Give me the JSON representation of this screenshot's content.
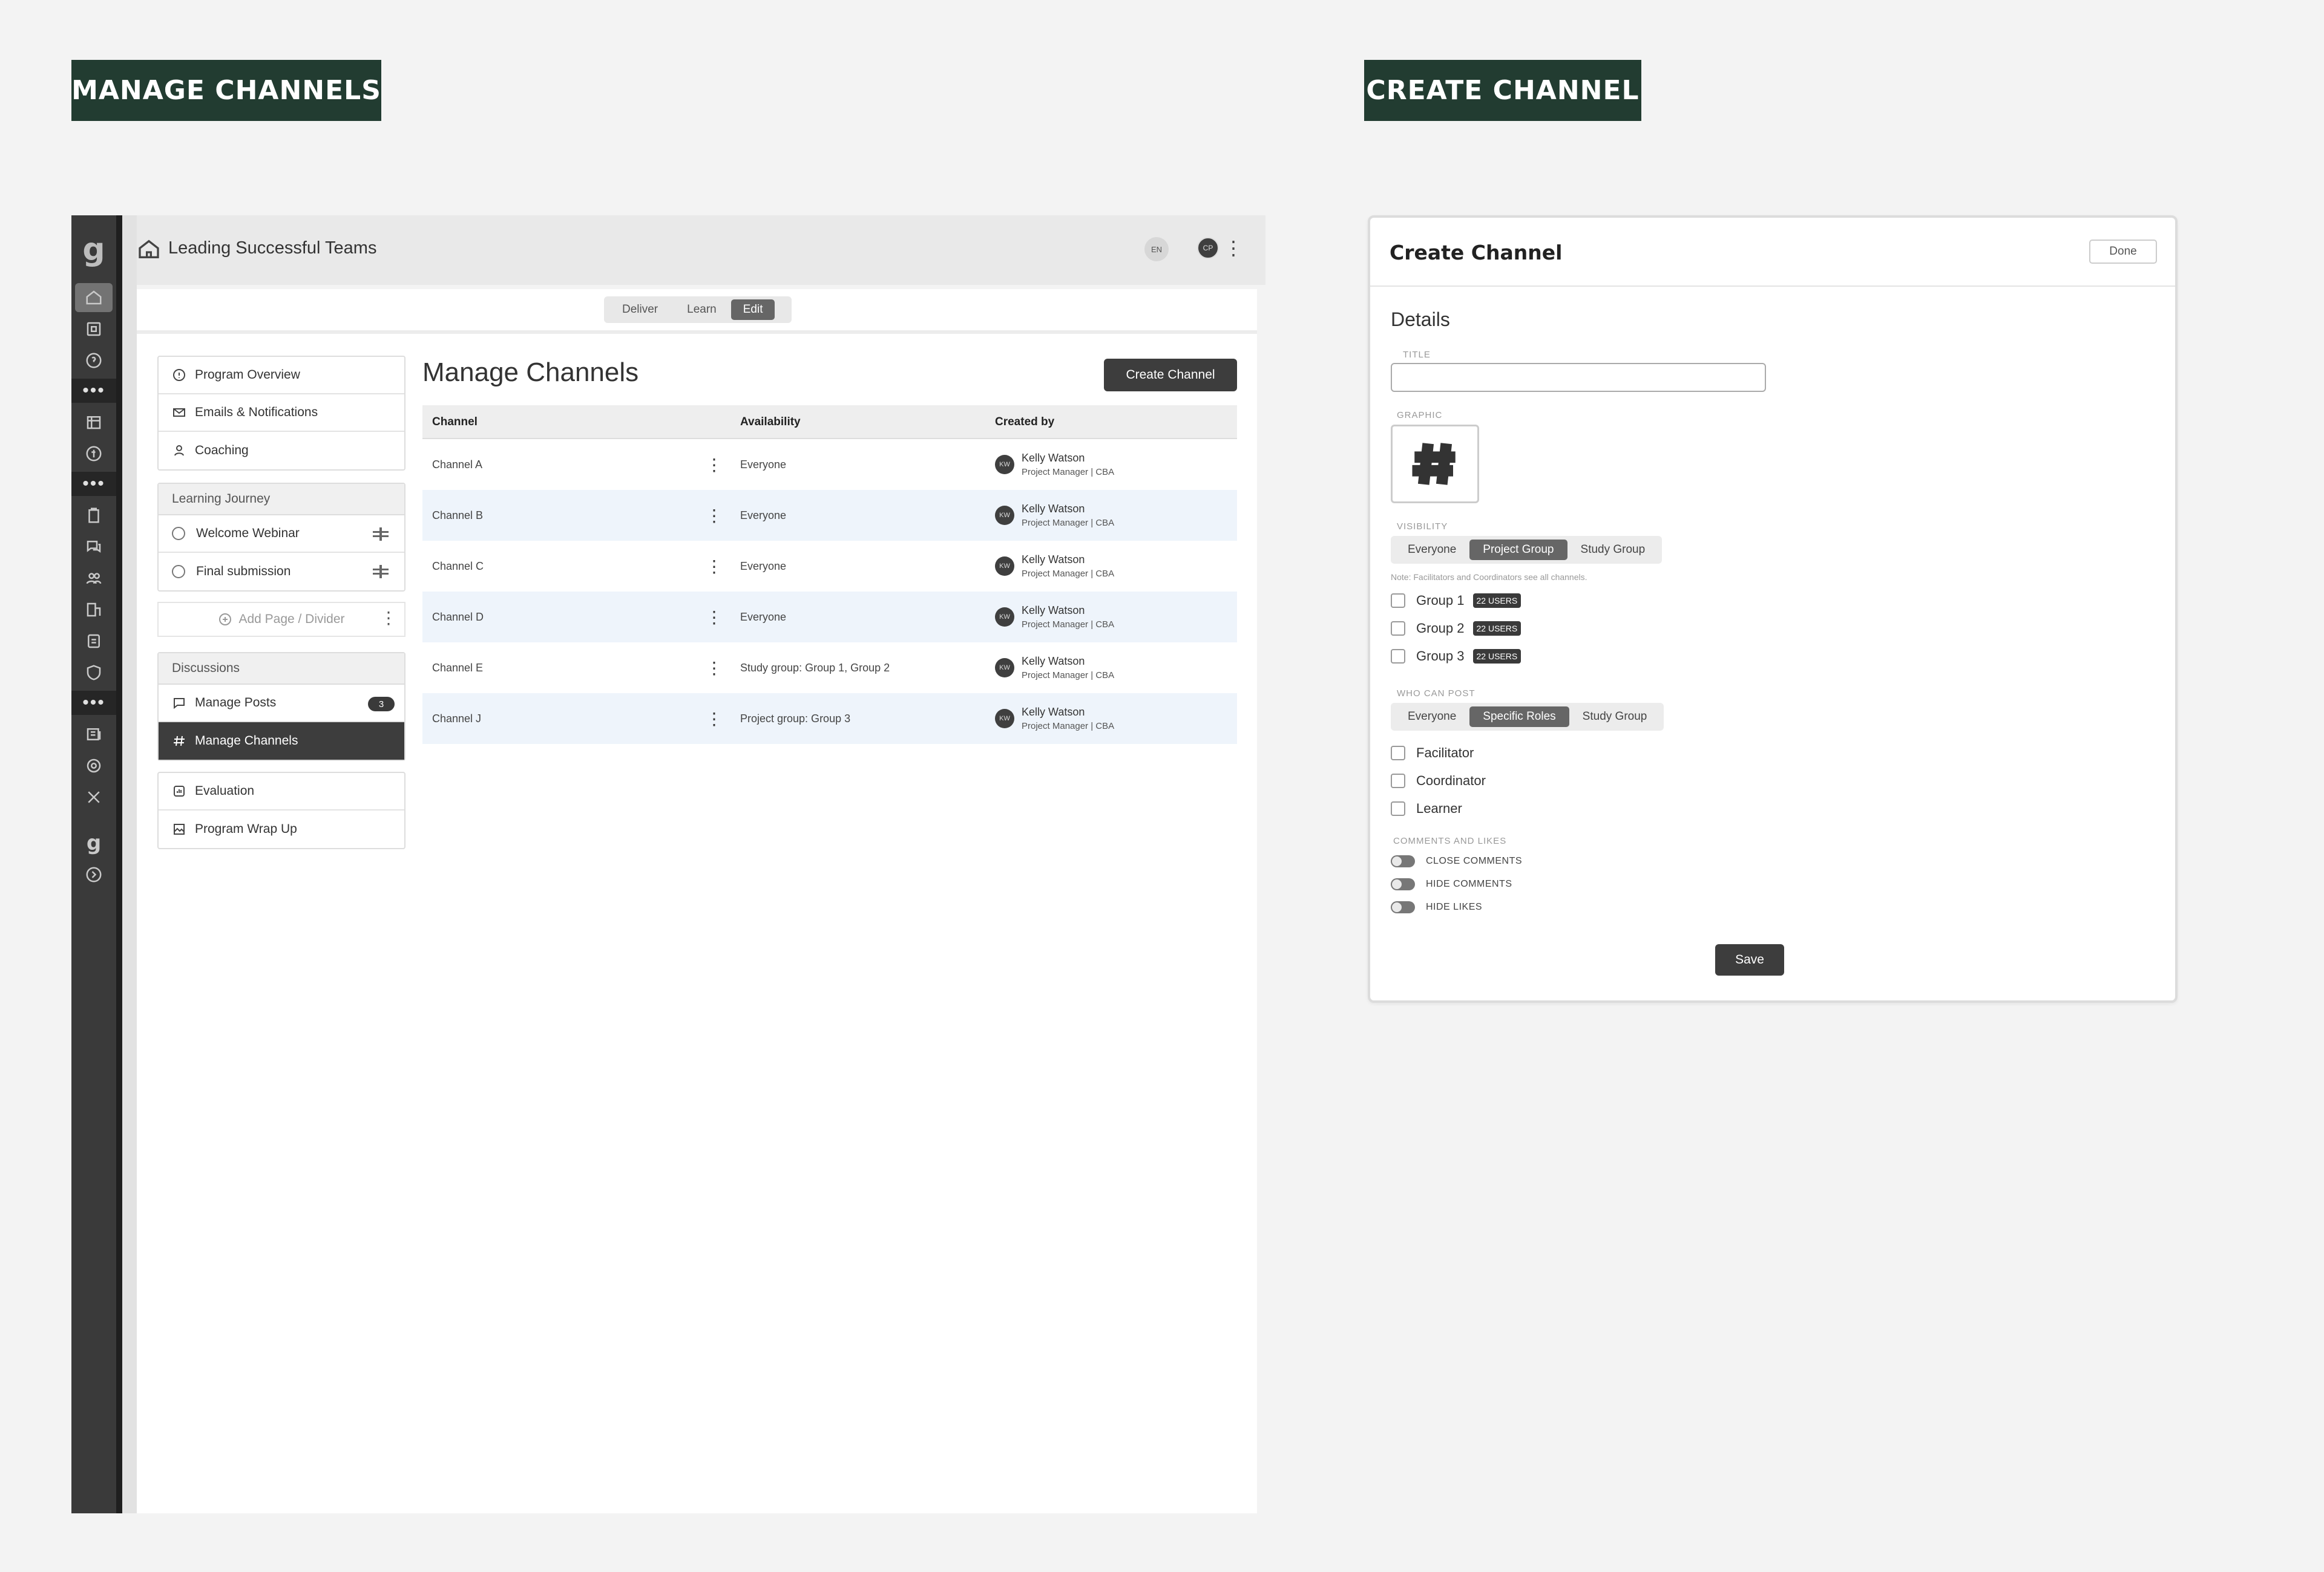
{
  "banners": {
    "left": "MANAGE CHANNELS",
    "right": "CREATE CHANNEL"
  },
  "rail": {
    "logo": "g",
    "icons": [
      "home-icon",
      "book-icon",
      "help-icon",
      "more-icon",
      "calendar-icon",
      "money-icon",
      "more-icon",
      "clipboard-icon",
      "chat-icon",
      "users-icon",
      "building-icon",
      "report-icon",
      "shield-icon",
      "more-icon",
      "news-icon",
      "settings-icon",
      "tools-icon",
      "logo-icon",
      "expand-icon"
    ],
    "dots": "•••",
    "bottom_logo": "g"
  },
  "topbar": {
    "title": "Leading Successful Teams",
    "lang": "EN",
    "avatar": "CP"
  },
  "modes": [
    "Deliver",
    "Learn",
    "Edit"
  ],
  "active_mode": "Edit",
  "nav": {
    "top_items": [
      "Program Overview",
      "Emails & Notifications",
      "Coaching"
    ],
    "journey_header": "Learning Journey",
    "journey_items": [
      "Welcome Webinar",
      "Final submission"
    ],
    "add_page": "Add Page / Divider",
    "discussions_header": "Discussions",
    "discussion_items": [
      "Manage Posts",
      "Manage Channels"
    ],
    "manage_posts_count": "3",
    "bottom_items": [
      "Evaluation",
      "Program Wrap Up"
    ]
  },
  "main": {
    "title": "Manage Channels",
    "create_button": "Create Channel",
    "columns": [
      "Channel",
      "Availability",
      "Created by"
    ],
    "rows": [
      {
        "channel": "Channel A",
        "availability": "Everyone",
        "initials": "KW",
        "name": "Kelly Watson",
        "role": "Project Manager | CBA"
      },
      {
        "channel": "Channel B",
        "availability": "Everyone",
        "initials": "KW",
        "name": "Kelly Watson",
        "role": "Project Manager | CBA"
      },
      {
        "channel": "Channel C",
        "availability": "Everyone",
        "initials": "KW",
        "name": "Kelly Watson",
        "role": "Project Manager | CBA"
      },
      {
        "channel": "Channel D",
        "availability": "Everyone",
        "initials": "KW",
        "name": "Kelly Watson",
        "role": "Project Manager | CBA"
      },
      {
        "channel": "Channel E",
        "availability": "Study group: Group 1, Group 2",
        "initials": "KW",
        "name": "Kelly Watson",
        "role": "Project Manager | CBA"
      },
      {
        "channel": "Channel J",
        "availability": "Project group: Group 3",
        "initials": "KW",
        "name": "Kelly Watson",
        "role": "Project Manager | CBA"
      }
    ]
  },
  "panel": {
    "title": "Create Channel",
    "done": "Done",
    "details": "Details",
    "title_label": "TITLE",
    "title_value": "",
    "graphic_label": "GRAPHIC",
    "visibility_label": "VISIBILITY",
    "visibility_options": [
      "Everyone",
      "Project Group",
      "Study Group"
    ],
    "visibility_selected": "Project Group",
    "note": "Note: Facilitators and Coordinators see all channels.",
    "groups": [
      {
        "name": "Group 1",
        "users": "22 USERS"
      },
      {
        "name": "Group 2",
        "users": "22 USERS"
      },
      {
        "name": "Group 3",
        "users": "22 USERS"
      }
    ],
    "who_label": "WHO CAN POST",
    "who_options": [
      "Everyone",
      "Specific Roles",
      "Study Group"
    ],
    "who_selected": "Specific Roles",
    "roles": [
      "Facilitator",
      "Coordinator",
      "Learner"
    ],
    "comments_label": "COMMENTS AND LIKES",
    "toggles": [
      "CLOSE COMMENTS",
      "HIDE COMMENTS",
      "HIDE LIKES"
    ],
    "save": "Save"
  }
}
